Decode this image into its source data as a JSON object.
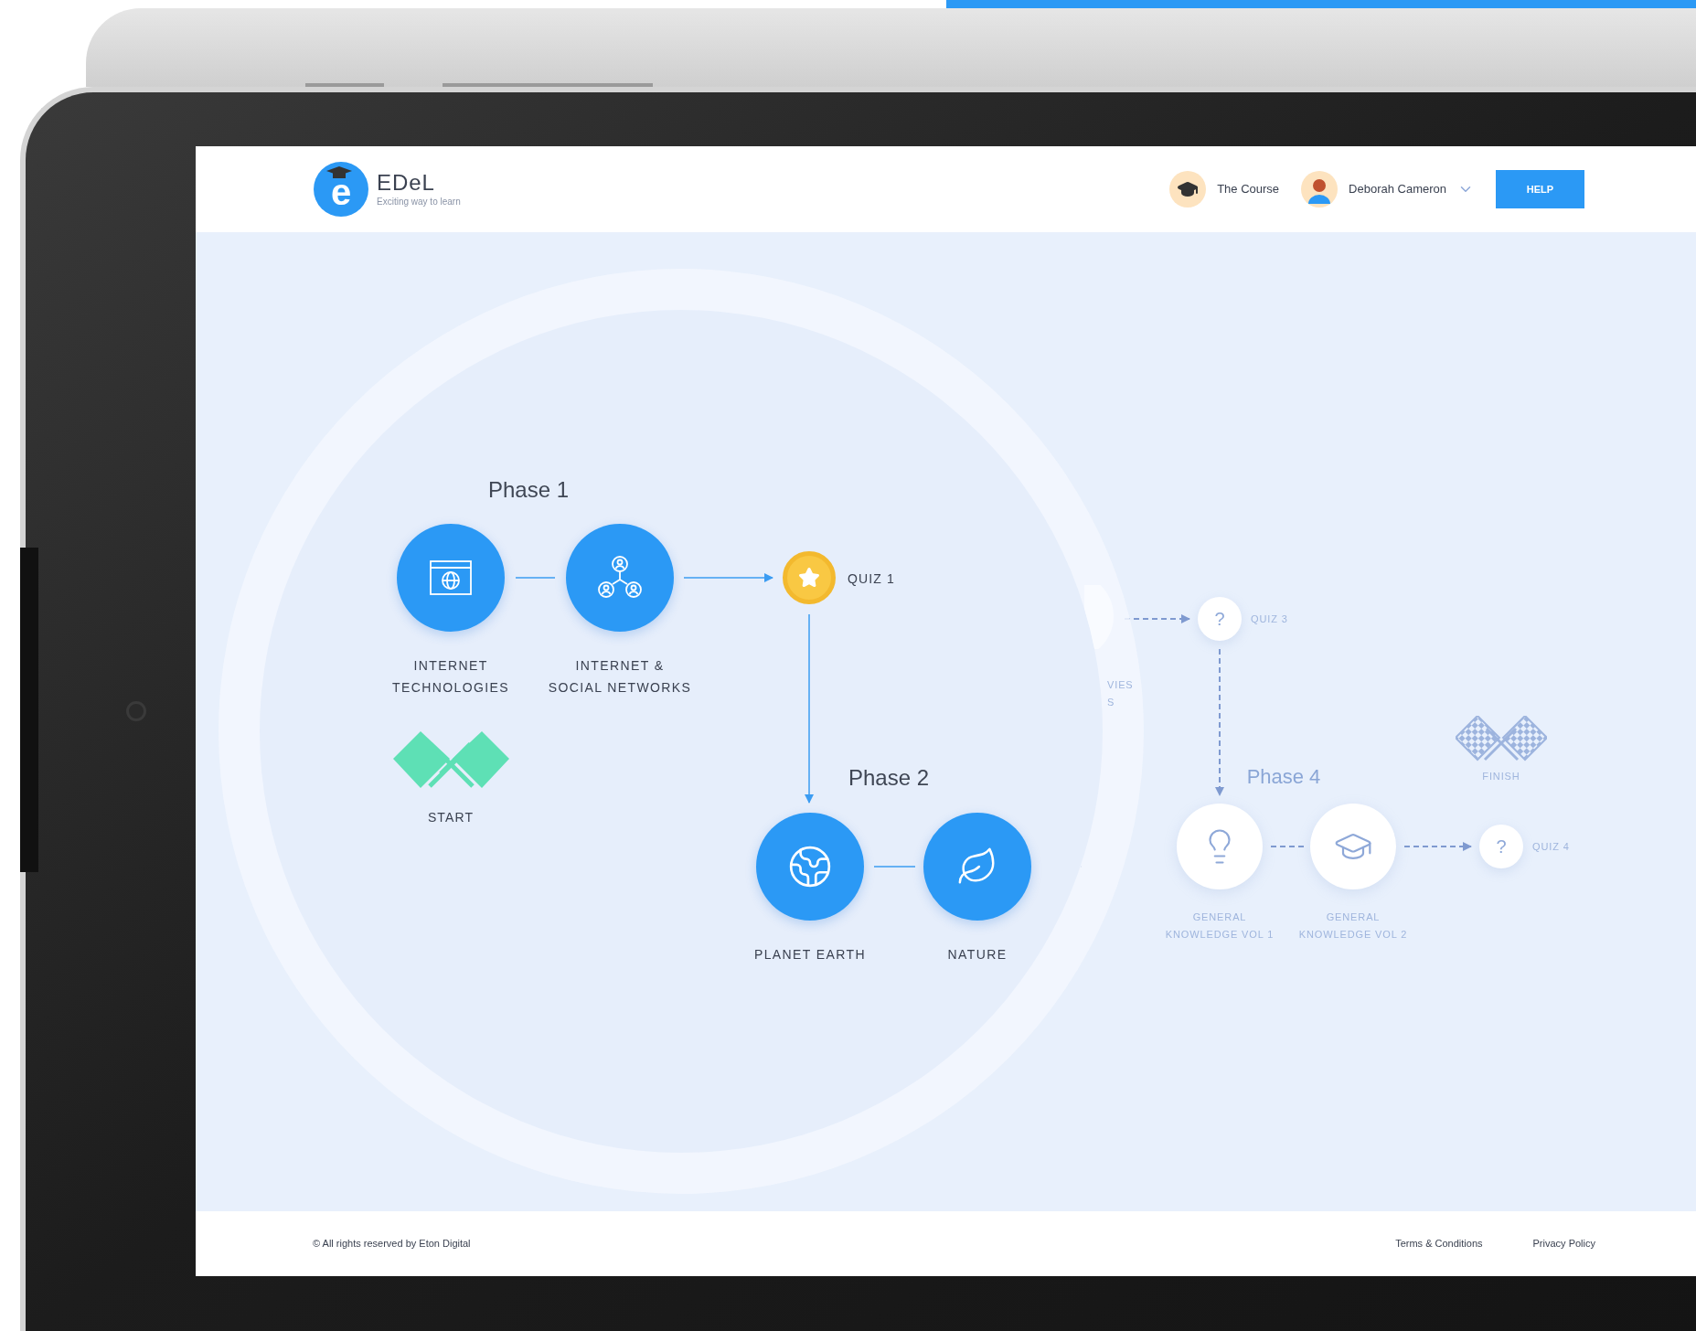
{
  "header": {
    "logo": {
      "mark": "e",
      "name": "EDeL",
      "tagline": "Exciting way to learn"
    },
    "nav": [
      {
        "kind": "course",
        "label": "The Course"
      },
      {
        "kind": "user",
        "label": "Deborah Cameron"
      }
    ],
    "help_button": "HELP"
  },
  "phases": [
    {
      "label": "Phase 1",
      "locked": false
    },
    {
      "label": "Phase 2",
      "locked": false
    },
    {
      "label": "Phase 4",
      "locked": true
    }
  ],
  "nodes": [
    {
      "kind": "course",
      "label_lines": [
        "INTERNET",
        "TECHNOLOGIES"
      ],
      "locked": false,
      "partial": false
    },
    {
      "kind": "course",
      "label_lines": [
        "INTERNET &",
        "SOCIAL NETWORKS"
      ],
      "locked": false,
      "partial": false
    },
    {
      "kind": "quiz",
      "label": "QUIZ 1",
      "passed": true,
      "locked": false
    },
    {
      "kind": "start",
      "label": "START"
    },
    {
      "kind": "course",
      "label_lines": [
        "PLANET EARTH"
      ],
      "locked": false,
      "partial": false
    },
    {
      "kind": "course",
      "label_lines": [
        "NATURE"
      ],
      "locked": false,
      "partial": false
    },
    {
      "kind": "course",
      "label_lines": [
        "VIES",
        "S"
      ],
      "locked": true,
      "partial": true
    },
    {
      "kind": "quiz",
      "label": "QUIZ 3",
      "symbol": "?",
      "passed": false,
      "locked": true
    },
    {
      "kind": "finish",
      "label": "FINISH"
    },
    {
      "kind": "course",
      "label_lines": [
        "GENERAL",
        "KNOWLEDGE VOL 1"
      ],
      "locked": true,
      "partial": false
    },
    {
      "kind": "course",
      "label_lines": [
        "GENERAL",
        "KNOWLEDGE VOL 2"
      ],
      "locked": true,
      "partial": false
    },
    {
      "kind": "quiz",
      "label": "QUIZ 4",
      "symbol": "?",
      "passed": false,
      "locked": true
    }
  ],
  "footer": {
    "copyright": "© All rights reserved by Eton Digital",
    "links": [
      "Terms & Conditions",
      "Privacy Policy"
    ]
  }
}
